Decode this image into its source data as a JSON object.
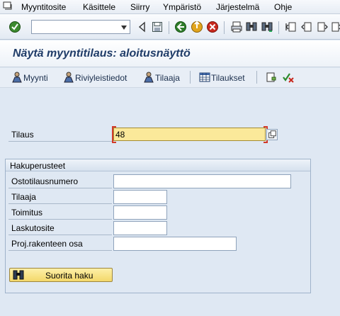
{
  "menu": {
    "items": [
      "Myyntitosite",
      "Käsittele",
      "Siirry",
      "Ympäristö",
      "Järjestelmä",
      "Ohje"
    ]
  },
  "toolbar": {
    "command_value": "",
    "icons": [
      "enter-icon",
      "back-arrow-icon",
      "save-icon",
      "back-icon",
      "exit-icon",
      "cancel-icon",
      "print-icon",
      "find-icon",
      "find-next-icon",
      "first-page-icon",
      "previous-page-icon",
      "next-page-icon",
      "last-page-icon"
    ]
  },
  "title": "Näytä myyntitilaus: aloitusnäyttö",
  "app_toolbar": {
    "buttons": [
      "Myynti",
      "Riviyleistiedot",
      "Tilaaja",
      "Tilaukset"
    ]
  },
  "order": {
    "label": "Tilaus",
    "value": "48"
  },
  "search_criteria": {
    "title": "Hakuperusteet",
    "fields": [
      {
        "label": "Ostotilausnumero",
        "value": ""
      },
      {
        "label": "Tilaaja",
        "value": ""
      },
      {
        "label": "Toimitus",
        "value": ""
      },
      {
        "label": "Laskutosite",
        "value": ""
      },
      {
        "label": "Proj.rakenteen osa",
        "value": ""
      }
    ],
    "execute_label": "Suorita haku"
  },
  "colors": {
    "background": "#dfe8f3",
    "title_text": "#1f3c68",
    "required_field": "#fbe99a",
    "execute_button": "#f3d86a"
  }
}
